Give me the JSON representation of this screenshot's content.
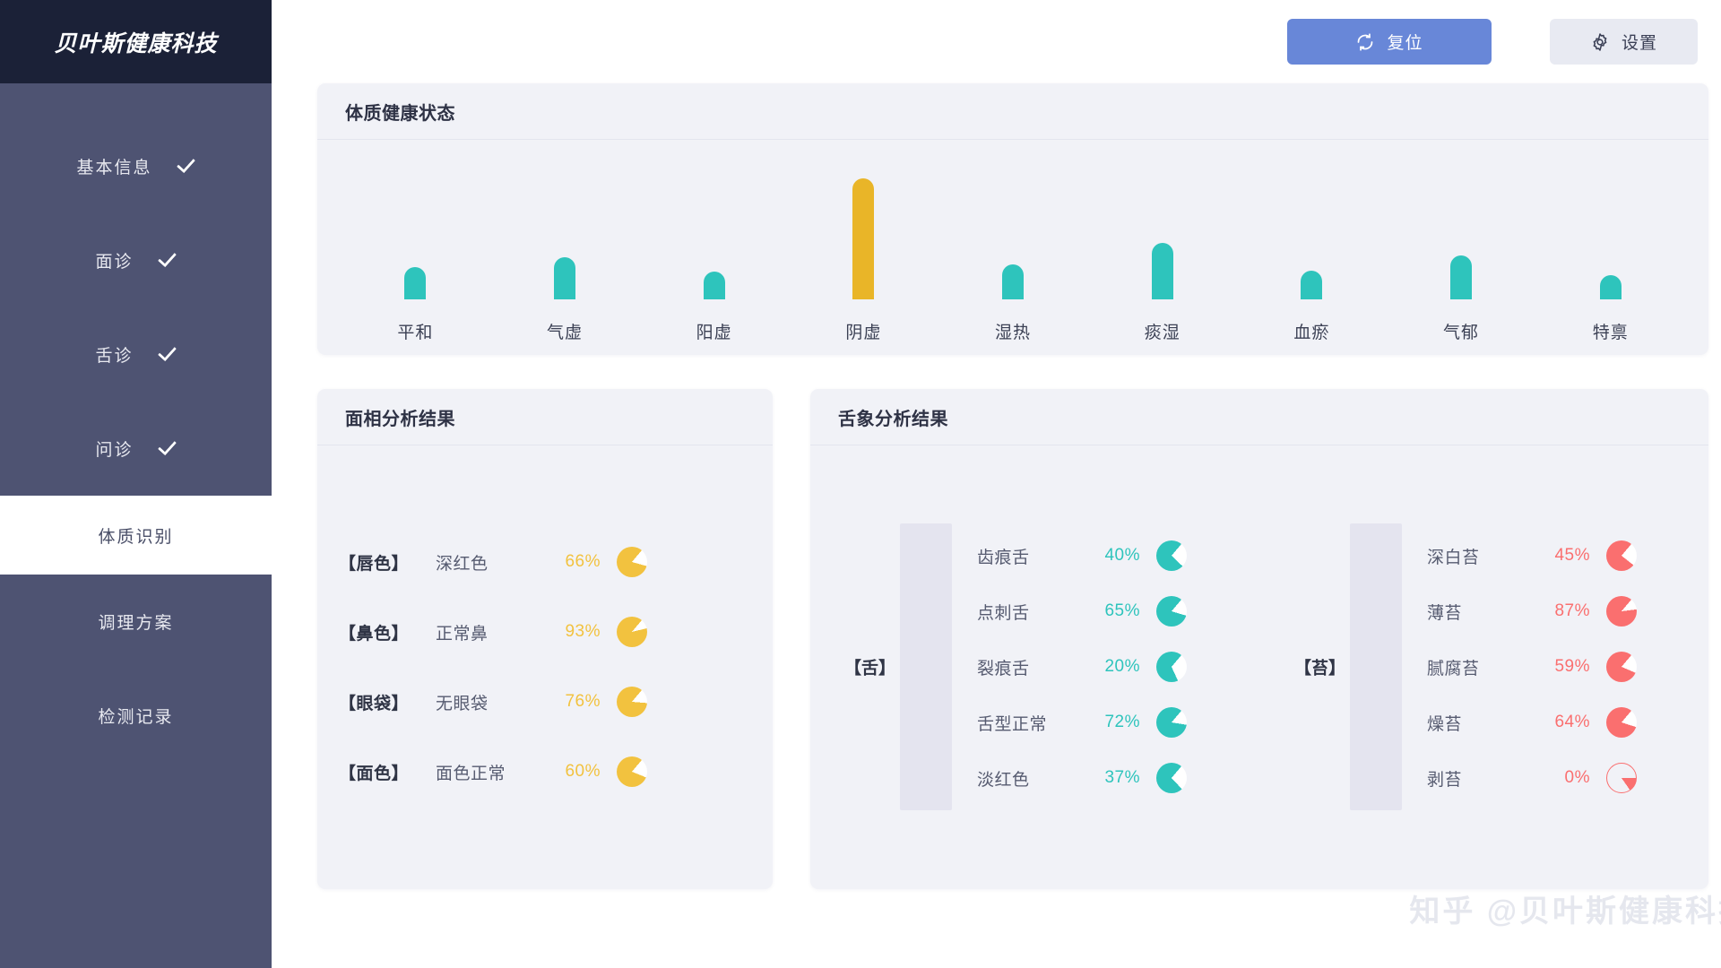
{
  "brand": {
    "name": "贝叶斯健康科技"
  },
  "sidebar": {
    "items": [
      {
        "label": "基本信息",
        "checked": true,
        "active": false
      },
      {
        "label": "面诊",
        "checked": true,
        "active": false
      },
      {
        "label": "舌诊",
        "checked": true,
        "active": false
      },
      {
        "label": "问诊",
        "checked": true,
        "active": false
      },
      {
        "label": "体质识别",
        "checked": false,
        "active": true
      },
      {
        "label": "调理方案",
        "checked": false,
        "active": false
      },
      {
        "label": "检测记录",
        "checked": false,
        "active": false
      }
    ]
  },
  "toolbar": {
    "reset_label": "复位",
    "reset_icon": "refresh-icon",
    "settings_label": "设置",
    "settings_icon": "gear-icon"
  },
  "chart_card": {
    "title": "体质健康状态"
  },
  "chart_data": {
    "type": "bar",
    "title": "体质健康状态",
    "xlabel": "",
    "ylabel": "",
    "ylim": [
      0,
      100
    ],
    "grid": false,
    "legend": "none",
    "categories": [
      "平和",
      "气虚",
      "阳虚",
      "阴虚",
      "湿热",
      "痰湿",
      "血瘀",
      "气郁",
      "特禀"
    ],
    "values": [
      27,
      35,
      23,
      100,
      29,
      47,
      24,
      36,
      20
    ],
    "colors": [
      "#2ec4bc",
      "#2ec4bc",
      "#2ec4bc",
      "#e9b528",
      "#2ec4bc",
      "#2ec4bc",
      "#2ec4bc",
      "#2ec4bc",
      "#2ec4bc"
    ],
    "highlight_category": "阴虚",
    "highlight_color": "#e9b528",
    "base_color": "#2ec4bc"
  },
  "face_card": {
    "title": "面相分析结果",
    "accent": "#f2c23f",
    "rows": [
      {
        "key": "【唇色】",
        "value": "深红色",
        "percent": "66%",
        "ratio": 66
      },
      {
        "key": "【鼻色】",
        "value": "正常鼻",
        "percent": "93%",
        "ratio": 93
      },
      {
        "key": "【眼袋】",
        "value": "无眼袋",
        "percent": "76%",
        "ratio": 76
      },
      {
        "key": "【面色】",
        "value": "面色正常",
        "percent": "60%",
        "ratio": 60
      }
    ]
  },
  "tongue_card": {
    "title": "舌象分析结果",
    "groups": [
      {
        "band_label": "【舌】",
        "accent": "#2ec4bc",
        "rows": [
          {
            "name": "齿痕舌",
            "percent": "40%",
            "ratio": 40
          },
          {
            "name": "点刺舌",
            "percent": "65%",
            "ratio": 65
          },
          {
            "name": "裂痕舌",
            "percent": "20%",
            "ratio": 20
          },
          {
            "name": "舌型正常",
            "percent": "72%",
            "ratio": 72
          },
          {
            "name": "淡红色",
            "percent": "37%",
            "ratio": 37
          }
        ]
      },
      {
        "band_label": "【苔】",
        "accent": "#fa6f6f",
        "rows": [
          {
            "name": "深白苔",
            "percent": "45%",
            "ratio": 45
          },
          {
            "name": "薄苔",
            "percent": "87%",
            "ratio": 87
          },
          {
            "name": "腻腐苔",
            "percent": "59%",
            "ratio": 59
          },
          {
            "name": "燥苔",
            "percent": "64%",
            "ratio": 64
          },
          {
            "name": "剥苔",
            "percent": "0%",
            "ratio": 0
          }
        ]
      }
    ]
  },
  "watermark": {
    "text": "知乎 @贝叶斯健康科技"
  },
  "theme": {
    "sidebar_bg": "#4e5372",
    "brand_bg": "#1b2137",
    "card_bg": "#f1f2f7",
    "primary": "#6887d8",
    "teal": "#2ec4bc",
    "yellow": "#e9b528",
    "pink": "#fa6f6f"
  }
}
